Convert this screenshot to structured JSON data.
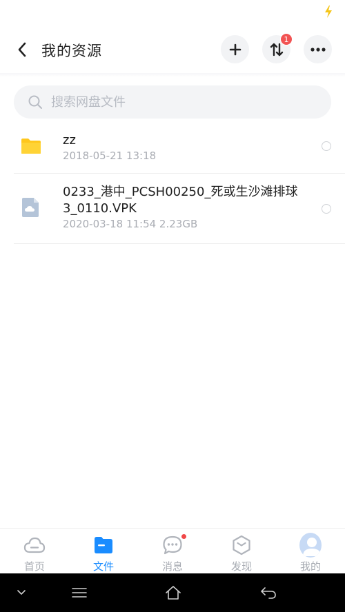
{
  "header": {
    "title": "我的资源",
    "transfer_badge": "1"
  },
  "search": {
    "placeholder": "搜索网盘文件"
  },
  "files": [
    {
      "name": "zz",
      "meta": "2018-05-21  13:18",
      "icon": "folder-icon"
    },
    {
      "name": "0233_港中_PCSH00250_死或生沙滩排球3_0110.VPK",
      "meta": "2020-03-18  11:54  2.23GB",
      "icon": "cloud-file-icon"
    }
  ],
  "tabs": [
    {
      "label": "首页",
      "icon": "cloud-home-icon"
    },
    {
      "label": "文件",
      "icon": "folder-icon",
      "active": true
    },
    {
      "label": "消息",
      "icon": "chat-bubble-icon"
    },
    {
      "label": "发现",
      "icon": "discover-box-icon"
    },
    {
      "label": "我的",
      "icon": "avatar-icon"
    }
  ],
  "colors": {
    "accent": "#1a8cff",
    "badge": "#f25353",
    "folder": "#ffc71c",
    "status_bolt": "#f5c518"
  }
}
